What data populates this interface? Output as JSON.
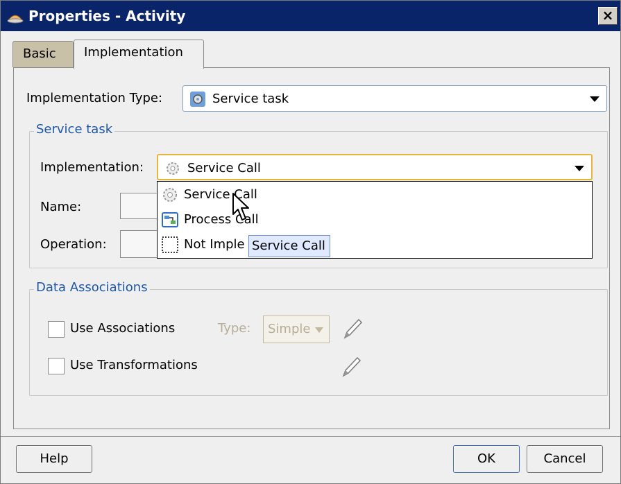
{
  "window": {
    "title": "Properties - Activity",
    "close_label": "×"
  },
  "tabs": [
    {
      "label": "Basic"
    },
    {
      "label": "Implementation"
    }
  ],
  "implementation_type": {
    "label": "Implementation Type:",
    "value": "Service task",
    "icon": "gear-icon"
  },
  "service_task_group": {
    "title": "Service task",
    "implementation": {
      "label": "Implementation:",
      "value": "Service Call",
      "icon": "gear-icon"
    },
    "name_label": "Name:",
    "operation_label": "Operation:"
  },
  "dropdown": {
    "options": [
      {
        "label": "Service Call",
        "icon": "gear-icon"
      },
      {
        "label": "Process Call",
        "icon": "process-icon"
      },
      {
        "label": "Not Imple",
        "icon": "dashed-box-icon"
      }
    ],
    "tooltip": "Service Call"
  },
  "data_associations": {
    "title": "Data Associations",
    "use_associations": "Use Associations",
    "type_label": "Type:",
    "type_value": "Simple",
    "use_transformations": "Use Transformations"
  },
  "buttons": {
    "help": "Help",
    "ok": "OK",
    "cancel": "Cancel"
  }
}
